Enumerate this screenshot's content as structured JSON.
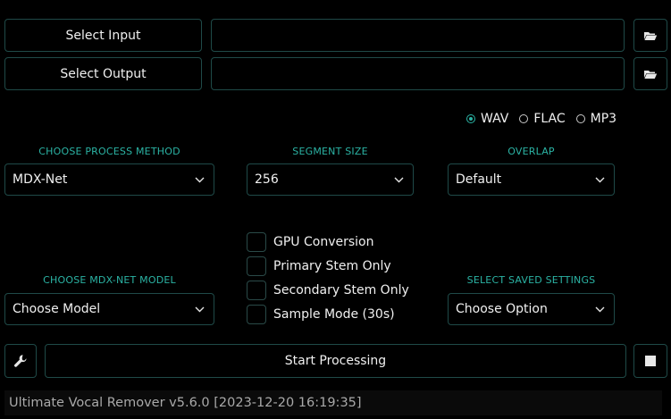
{
  "io": {
    "select_input_label": "Select Input",
    "select_output_label": "Select Output",
    "input_path": "",
    "output_path": ""
  },
  "format": {
    "options": [
      "WAV",
      "FLAC",
      "MP3"
    ],
    "selected": "WAV"
  },
  "process_method": {
    "label": "CHOOSE PROCESS METHOD",
    "value": "MDX-Net"
  },
  "segment_size": {
    "label": "SEGMENT SIZE",
    "value": "256"
  },
  "overlap": {
    "label": "OVERLAP",
    "value": "Default"
  },
  "mdx_model": {
    "label": "CHOOSE MDX-NET MODEL",
    "value": "Choose Model"
  },
  "saved_settings": {
    "label": "SELECT SAVED SETTINGS",
    "value": "Choose Option"
  },
  "options": [
    {
      "label": "GPU Conversion",
      "checked": false
    },
    {
      "label": "Primary Stem Only",
      "checked": false
    },
    {
      "label": "Secondary Stem Only",
      "checked": false
    },
    {
      "label": "Sample Mode (30s)",
      "checked": false
    }
  ],
  "actions": {
    "start_label": "Start Processing"
  },
  "status": {
    "text": "Ultimate Vocal Remover v5.6.0 [2023-12-20 16:19:35]"
  },
  "icons": {
    "folder": "folder-open-icon",
    "wrench": "wrench-icon",
    "stop": "stop-icon",
    "chevron": "chevron-down-icon"
  },
  "colors": {
    "accent": "#2bb3a4",
    "border": "#1f4a48",
    "background": "#000000"
  }
}
